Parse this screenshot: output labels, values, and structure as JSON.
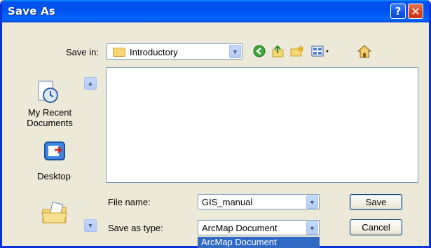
{
  "window": {
    "title": "Save As"
  },
  "titlebar": {
    "help_glyph": "?",
    "close_glyph": "✕"
  },
  "save_in": {
    "label": "Save in:",
    "value": "Introductory"
  },
  "toolbar": {
    "icons": [
      "back-icon",
      "up-folder-icon",
      "new-folder-icon",
      "views-menu-icon",
      "home-icon"
    ]
  },
  "places": [
    {
      "label_line1": "My Recent",
      "label_line2": "Documents",
      "icon": "recent-documents-icon"
    },
    {
      "label_line1": "Desktop",
      "label_line2": "",
      "icon": "desktop-icon"
    },
    {
      "label_line1": "",
      "label_line2": "",
      "icon": "my-documents-icon"
    }
  ],
  "file_name": {
    "label": "File name:",
    "value": "GIS_manual"
  },
  "save_as_type": {
    "label": "Save as type:",
    "value": "ArcMap Document",
    "dropdown_highlight": "ArcMap Document"
  },
  "buttons": {
    "save": "Save",
    "cancel": "Cancel"
  },
  "colors": {
    "titlebar": "#0050ee",
    "dialog_bg": "#ece9d8",
    "selection": "#316ac5"
  }
}
